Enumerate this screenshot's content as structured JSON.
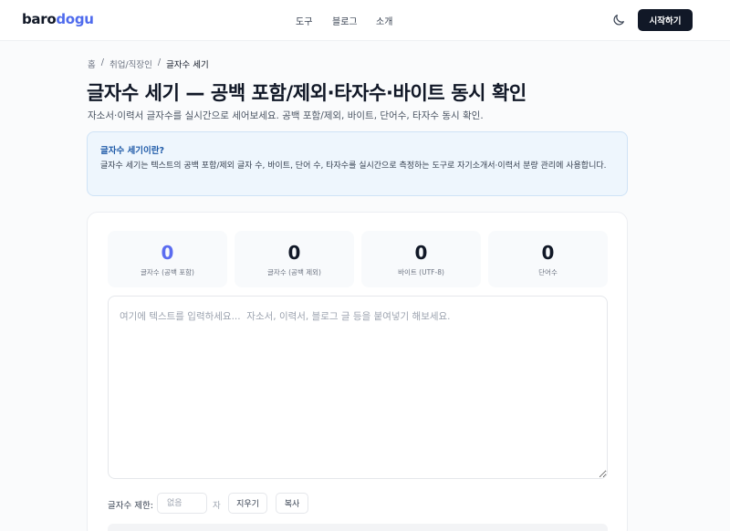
{
  "header": {
    "logo_part1": "baro",
    "logo_part2": "dogu",
    "nav": [
      "도구",
      "블로그",
      "소개"
    ],
    "theme_icon": "moon-icon",
    "cta_label": "시작하기"
  },
  "breadcrumb": [
    "홈",
    "/",
    "취업/직장인",
    "/",
    "글자수 세기"
  ],
  "page": {
    "title": "글자수 세기 — 공백 포함/제외·타자수·바이트 동시 확인",
    "subtitle": "자소서·이력서 글자수를 실시간으로 세어보세요. 공백 포함/제외, 바이트, 단어수, 타자수 동시 확인."
  },
  "info": {
    "title": "글자수 세기이란?",
    "body": "글자수 세기는 텍스트의 공백 포함/제외 글자 수, 바이트, 단어 수, 타자수를 실시간으로 측정하는 도구로 자기소개서·이력서 분량 관리에 사용합니다."
  },
  "stats": [
    {
      "value": "0",
      "label": "글자수 (공백 포함)"
    },
    {
      "value": "0",
      "label": "글자수 (공백 제외)"
    },
    {
      "value": "0",
      "label": "바이트 (UTF-8)"
    },
    {
      "value": "0",
      "label": "단어수"
    }
  ],
  "editor": {
    "placeholder": "여기에 텍스트를 입력하세요...  자소서, 이력서, 블로그 글 등을 붙여넣기 해보세요.",
    "value": ""
  },
  "limit": {
    "label": "글자수 제한:",
    "placeholder": "없음",
    "unit": "자"
  },
  "actions": {
    "clear_label": "지우기",
    "copy_label": "복사"
  },
  "colors": {
    "brand": "#4f6bed",
    "accent_stat": "#5b6cf0",
    "cta_bg": "#111827",
    "info_bg": "#eef6fd",
    "info_title": "#1e5aa8"
  }
}
